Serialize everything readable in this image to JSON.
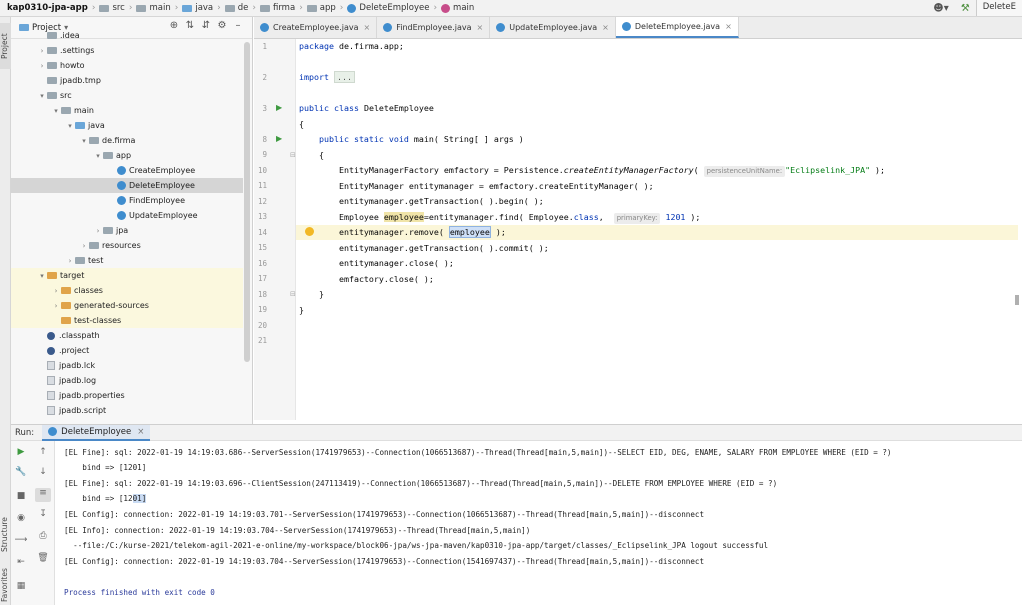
{
  "breadcrumb": [
    "kap0310-jpa-app",
    "src",
    "main",
    "java",
    "de",
    "firma",
    "app",
    "DeleteEmployee",
    "main"
  ],
  "toolbar": {
    "run_config": "DeleteE"
  },
  "left_strip": {
    "project_tab": "Project",
    "structure_tab": "Structure",
    "favorites_tab": "Favorites"
  },
  "project": {
    "title": "Project",
    "tree": [
      {
        "label": ".idea",
        "depth": 1,
        "arrow": "",
        "icon": "folder",
        "state": ""
      },
      {
        "label": ".settings",
        "depth": 1,
        "arrow": ">",
        "icon": "folder",
        "state": ""
      },
      {
        "label": "howto",
        "depth": 1,
        "arrow": ">",
        "icon": "folder",
        "state": ""
      },
      {
        "label": "jpadb.tmp",
        "depth": 1,
        "arrow": "",
        "icon": "folder",
        "state": ""
      },
      {
        "label": "src",
        "depth": 1,
        "arrow": "v",
        "icon": "folder",
        "state": ""
      },
      {
        "label": "main",
        "depth": 2,
        "arrow": "v",
        "icon": "folder",
        "state": ""
      },
      {
        "label": "java",
        "depth": 3,
        "arrow": "v",
        "icon": "folder-blue",
        "state": ""
      },
      {
        "label": "de.firma",
        "depth": 4,
        "arrow": "v",
        "icon": "folder",
        "state": ""
      },
      {
        "label": "app",
        "depth": 5,
        "arrow": "v",
        "icon": "folder",
        "state": ""
      },
      {
        "label": "CreateEmployee",
        "depth": 6,
        "arrow": "",
        "icon": "class",
        "state": ""
      },
      {
        "label": "DeleteEmployee",
        "depth": 6,
        "arrow": "",
        "icon": "class",
        "state": "selected"
      },
      {
        "label": "FindEmployee",
        "depth": 6,
        "arrow": "",
        "icon": "class",
        "state": ""
      },
      {
        "label": "UpdateEmployee",
        "depth": 6,
        "arrow": "",
        "icon": "class",
        "state": ""
      },
      {
        "label": "jpa",
        "depth": 5,
        "arrow": ">",
        "icon": "folder",
        "state": ""
      },
      {
        "label": "resources",
        "depth": 4,
        "arrow": ">",
        "icon": "folder",
        "state": ""
      },
      {
        "label": "test",
        "depth": 3,
        "arrow": ">",
        "icon": "folder",
        "state": ""
      },
      {
        "label": "target",
        "depth": 1,
        "arrow": "v",
        "icon": "folder-orange",
        "state": "yellow"
      },
      {
        "label": "classes",
        "depth": 2,
        "arrow": ">",
        "icon": "folder-orange",
        "state": "yellow"
      },
      {
        "label": "generated-sources",
        "depth": 2,
        "arrow": ">",
        "icon": "folder-orange",
        "state": "yellow"
      },
      {
        "label": "test-classes",
        "depth": 2,
        "arrow": "",
        "icon": "folder-orange",
        "state": "yellow"
      },
      {
        "label": ".classpath",
        "depth": 1,
        "arrow": "",
        "icon": "dot",
        "state": ""
      },
      {
        "label": ".project",
        "depth": 1,
        "arrow": "",
        "icon": "dot",
        "state": ""
      },
      {
        "label": "jpadb.lck",
        "depth": 1,
        "arrow": "",
        "icon": "file",
        "state": ""
      },
      {
        "label": "jpadb.log",
        "depth": 1,
        "arrow": "",
        "icon": "file",
        "state": ""
      },
      {
        "label": "jpadb.properties",
        "depth": 1,
        "arrow": "",
        "icon": "file",
        "state": ""
      },
      {
        "label": "jpadb.script",
        "depth": 1,
        "arrow": "",
        "icon": "file",
        "state": ""
      }
    ]
  },
  "editor_tabs": [
    {
      "label": "CreateEmployee.java",
      "active": false
    },
    {
      "label": "FindEmployee.java",
      "active": false
    },
    {
      "label": "UpdateEmployee.java",
      "active": false
    },
    {
      "label": "DeleteEmployee.java",
      "active": true
    }
  ],
  "editor": {
    "line_numbers": [
      "1",
      "2",
      "3",
      "7",
      "8",
      "9",
      "10",
      "11",
      "12",
      "13",
      "14",
      "15",
      "16",
      "17",
      "18",
      "19",
      "20",
      "21"
    ],
    "code": {
      "l1_kw": "package",
      "l1_rest": " de.firma.app;",
      "l3_kw": "import",
      "l3_fold": "...",
      "l8_kw": "public class",
      "l8_rest": " DeleteEmployee",
      "l9": "{",
      "l10_kw": "    public static void",
      "l10_rest": " main( String[ ] args )",
      "l11": "    {",
      "l12_a": "        EntityManagerFactory emfactory = Persistence.",
      "l12_m": "createEntityManagerFactory",
      "l12_b": "( ",
      "l12_hint": "persistenceUnitName:",
      "l12_str": "\"Eclipselink_JPA\"",
      "l12_c": " );",
      "l13": "        EntityManager entitymanager = emfactory.createEntityManager( );",
      "l14": "        entitymanager.getTransaction( ).begin( );",
      "l15_a": "        Employee ",
      "l15_v": "employee",
      "l15_b": "=entitymanager.find( Employee.",
      "l15_kw": "class",
      "l15_c": ",  ",
      "l15_hint": "primaryKey:",
      "l15_num": " 1201",
      "l15_d": " );",
      "l16_a": "        entitymanager.remove( ",
      "l16_v": "employee",
      "l16_b": " );",
      "l17": "        entitymanager.getTransaction( ).commit( );",
      "l18": "        entitymanager.close( );",
      "l19": "        emfactory.close( );",
      "l20": "    }",
      "l21": "}"
    }
  },
  "run": {
    "label": "Run:",
    "tab": "DeleteEmployee",
    "console": [
      "[EL Fine]: sql: 2022-01-19 14:19:03.686--ServerSession(1741979653)--Connection(1066513687)--Thread(Thread[main,5,main])--SELECT EID, DEG, ENAME, SALARY FROM EMPLOYEE WHERE (EID = ?)",
      "    bind => [1201]",
      "[EL Fine]: sql: 2022-01-19 14:19:03.696--ClientSession(247113419)--Connection(1066513687)--Thread(Thread[main,5,main])--DELETE FROM EMPLOYEE WHERE (EID = ?)",
      "    bind => [12",
      "01]",
      "[EL Config]: connection: 2022-01-19 14:19:03.701--ServerSession(1741979653)--Connection(1066513687)--Thread(Thread[main,5,main])--disconnect",
      "[EL Info]: connection: 2022-01-19 14:19:03.704--ServerSession(1741979653)--Thread(Thread[main,5,main])",
      "  --file:/C:/kurse-2021/telekom-agil-2021-e-online/my-workspace/block06-jpa/ws-jpa-maven/kap0310-jpa-app/target/classes/_Eclipselink_JPA logout successful",
      "[EL Config]: connection: 2022-01-19 14:19:03.704--ServerSession(1741979653)--Connection(1541697437)--Thread(Thread[main,5,main])--disconnect",
      "Process finished with exit code 0"
    ]
  }
}
